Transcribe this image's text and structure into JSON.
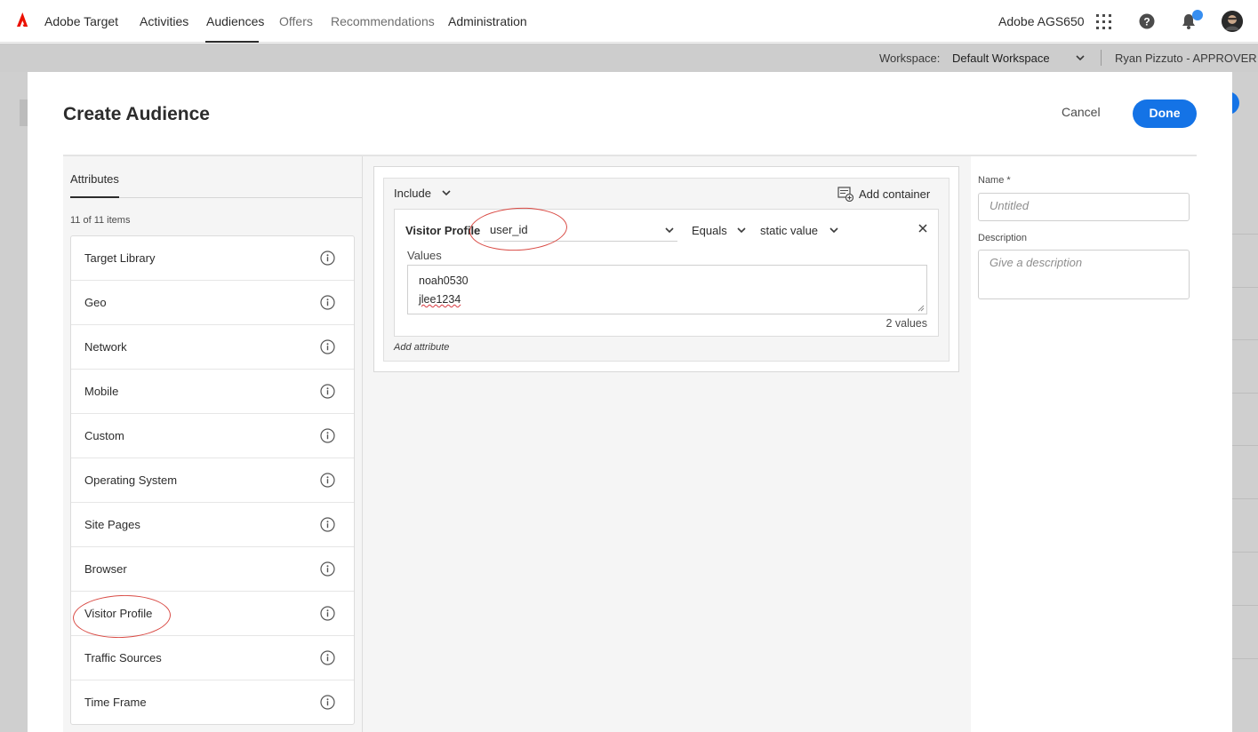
{
  "topnav": {
    "app_name": "Adobe Target",
    "items": [
      {
        "label": "Activities"
      },
      {
        "label": "Audiences"
      },
      {
        "label": "Offers"
      },
      {
        "label": "Recommendations"
      },
      {
        "label": "Administration"
      }
    ],
    "active": "Audiences",
    "org_name": "Adobe AGS650"
  },
  "workspace_bar": {
    "label": "Workspace:",
    "value": "Default Workspace",
    "user": "Ryan Pizzuto - APPROVER"
  },
  "modal": {
    "title": "Create Audience",
    "cancel_label": "Cancel",
    "done_label": "Done"
  },
  "attributes": {
    "tab_label": "Attributes",
    "count": "11 of 11 items",
    "items": [
      {
        "label": "Target Library"
      },
      {
        "label": "Geo"
      },
      {
        "label": "Network"
      },
      {
        "label": "Mobile"
      },
      {
        "label": "Custom"
      },
      {
        "label": "Operating System"
      },
      {
        "label": "Site Pages"
      },
      {
        "label": "Browser"
      },
      {
        "label": "Visitor Profile"
      },
      {
        "label": "Traffic Sources"
      },
      {
        "label": "Time Frame"
      }
    ]
  },
  "builder": {
    "include_label": "Include",
    "add_container_label": "Add container",
    "rule": {
      "attribute": "Visitor Profile",
      "field": "user_id",
      "operator": "Equals",
      "value_type": "static value",
      "values_label": "Values",
      "values": [
        "noah0530",
        "jlee1234"
      ],
      "values_count": "2 values"
    },
    "add_attribute_label": "Add attribute"
  },
  "details": {
    "name_label": "Name *",
    "name_placeholder": "Untitled",
    "description_label": "Description",
    "description_placeholder": "Give a description"
  },
  "colors": {
    "accent": "#1473e6",
    "adobe_red": "#eb1000",
    "annotation": "#d94a44",
    "notification": "#378ef0"
  }
}
